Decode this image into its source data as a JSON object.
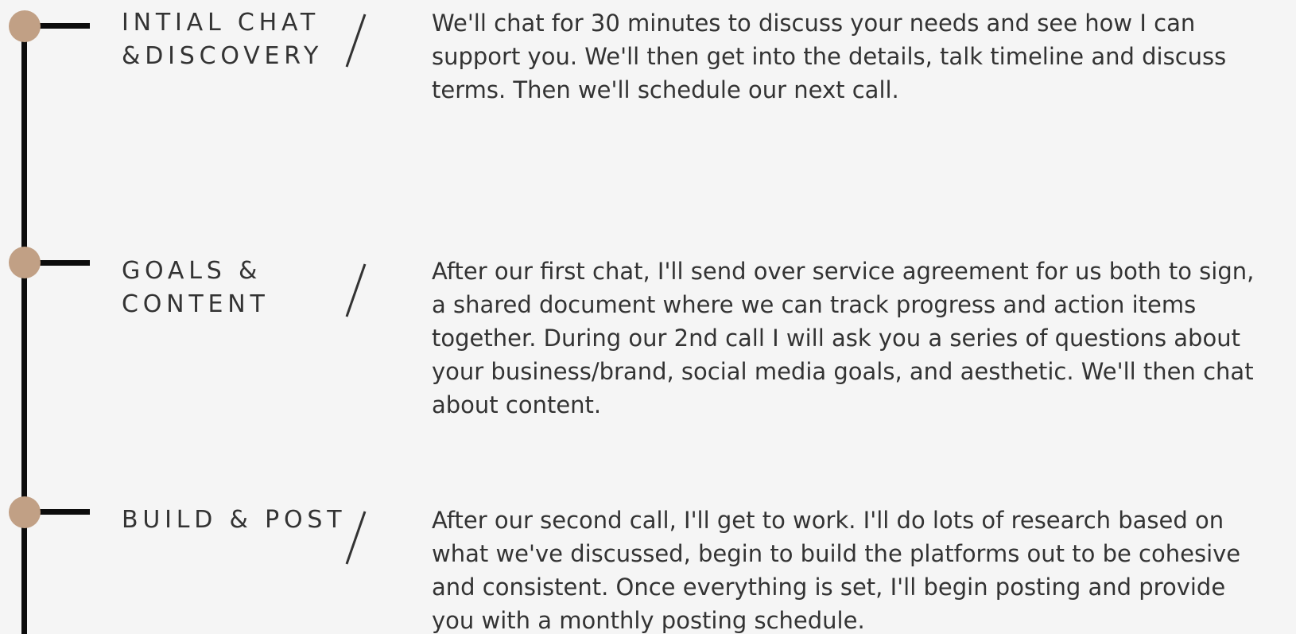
{
  "colors": {
    "background": "#f5f5f5",
    "timeline": "#0c0c0c",
    "node": "#c1a085",
    "text": "#333333"
  },
  "steps": [
    {
      "heading_lines": [
        "INTIAL CHAT",
        "&DISCOVERY"
      ],
      "divider_icon": "slash-divider-icon",
      "body_lines": [
        "We'll chat for 30 minutes to discuss your needs and see how I can",
        "support you. We'll then get into the details, talk timeline and discuss",
        "terms. Then we'll schedule our next call."
      ]
    },
    {
      "heading_lines": [
        "GOALS &",
        "CONTENT"
      ],
      "divider_icon": "slash-divider-icon",
      "body_lines": [
        "After our first chat, I'll send over service agreement for us both to sign,",
        "a shared document where we can track progress and action items",
        "together. During our 2nd call I will ask you a series of questions about",
        "your business/brand, social media goals, and aesthetic. We'll then chat",
        "about content."
      ]
    },
    {
      "heading_lines": [
        "BUILD & POST"
      ],
      "divider_icon": "slash-divider-icon",
      "body_lines": [
        "After our second call, I'll get to work. I'll do lots of research based on",
        "what we've discussed, begin to build the platforms out to be cohesive",
        "and consistent. Once everything is set, I'll begin posting and provide",
        "you with a monthly posting schedule."
      ]
    }
  ]
}
